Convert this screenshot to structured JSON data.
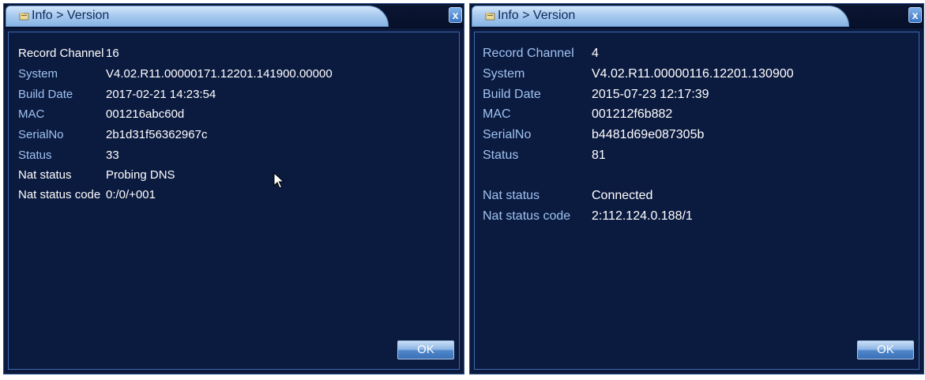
{
  "windows": [
    {
      "title": "Info > Version",
      "close_label": "x",
      "ok_label": "OK",
      "rows": [
        {
          "label": "Record Channel",
          "value": "16"
        },
        {
          "label": "System",
          "value": "V4.02.R11.00000171.12201.141900.00000"
        },
        {
          "label": "Build Date",
          "value": "2017-02-21 14:23:54"
        },
        {
          "label": "MAC",
          "value": "001216abc60d"
        },
        {
          "label": "SerialNo",
          "value": "2b1d31f56362967c"
        },
        {
          "label": "Status",
          "value": "33"
        },
        {
          "label": "Nat status",
          "value": "Probing DNS"
        },
        {
          "label": "Nat status code",
          "value": "0:/0/+001"
        }
      ]
    },
    {
      "title": "Info > Version",
      "close_label": "x",
      "ok_label": "OK",
      "rows": [
        {
          "label": "Record Channel",
          "value": "4"
        },
        {
          "label": "System",
          "value": "V4.02.R11.00000116.12201.130900"
        },
        {
          "label": "Build Date",
          "value": "2015-07-23 12:17:39"
        },
        {
          "label": "MAC",
          "value": "001212f6b882"
        },
        {
          "label": "SerialNo",
          "value": "b4481d69e087305b"
        },
        {
          "label": "Status",
          "value": "81"
        },
        {
          "label": "Nat status",
          "value": "Connected"
        },
        {
          "label": "Nat status code",
          "value": "2:112.124.0.188/1"
        }
      ]
    }
  ],
  "colors": {
    "panel_bg": "#0b1a3f",
    "label_blue": "#9fc3f0",
    "text_white": "#ffffff",
    "title_tab": "#a9cbef"
  },
  "icons": {
    "title_icon": "folder-icon",
    "cursor": "mouse-pointer-icon"
  }
}
